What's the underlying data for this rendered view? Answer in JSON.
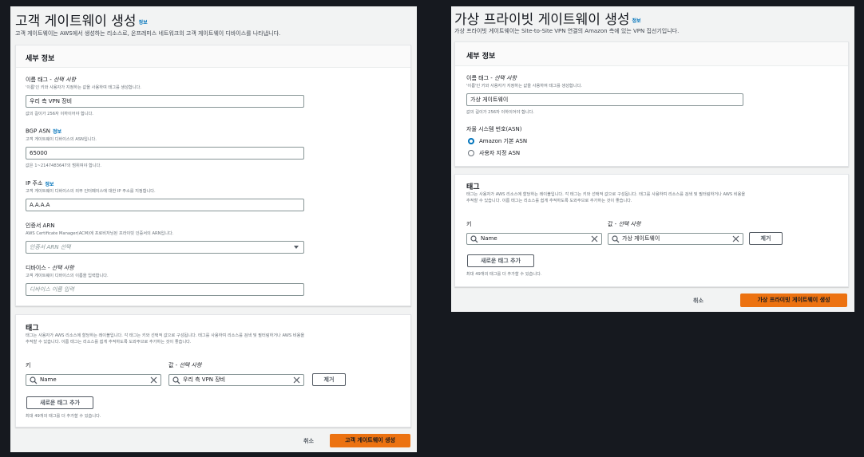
{
  "left": {
    "title": "고객 게이트웨이 생성",
    "info": "정보",
    "subtitle": "고객 게이트웨이는 AWS에서 생성하는 리소스로, 온프레미스 네트워크의 고객 게이트웨이 디바이스를 나타냅니다.",
    "details": {
      "heading": "세부 정보",
      "name_tag": {
        "label": "이름 태그",
        "optional": "선택 사항",
        "desc": "'이름'인 키와 사용자가 지정하는 값을 사용하여 태그를 생성합니다.",
        "value": "우리 측 VPN 장비",
        "hint": "값의 길이가 256자 이하이어야 합니다."
      },
      "bgp": {
        "label": "BGP ASN",
        "info": "정보",
        "desc": "고객 게이트웨이 디바이스의 ASN입니다.",
        "value": "65000",
        "hint": "값은 1~2147483647의 범위여야 합니다."
      },
      "ip": {
        "label": "IP 주소",
        "info": "정보",
        "desc": "고객 게이트웨이 디바이스의 외부 인터페이스에 대한 IP 주소를 지정합니다.",
        "value": "A.A.A.A"
      },
      "cert": {
        "label": "인증서 ARN",
        "desc": "AWS Certificate Manager(ACM)에 프로비저닝된 프라이빗 인증서의 ARN입니다.",
        "placeholder": "인증서 ARN 선택"
      },
      "device": {
        "label": "디바이스",
        "optional": "선택 사항",
        "desc": "고객 게이트웨이 디바이스의 이름을 입력합니다.",
        "placeholder": "디바이스 이름 입력"
      }
    },
    "tags": {
      "heading": "태그",
      "desc1": "태그는 사용자가 AWS 리소스에 할당하는 레이블입니다. 각 태그는 키와 선택적 값으로 구성됩니다. 태그를 사용하여 리소스를 검색 및 필터링하거나 AWS 비용을",
      "desc2": "추적할 수 있습니다. 이름 태그는 리소스를 쉽게 추적하도록 도와주므로 추가하는 것이 좋습니다.",
      "key_label": "키",
      "value_label": "값",
      "value_optional": "선택 사항",
      "key_value": "Name",
      "value_value": "우리 측 VPN 장비",
      "remove": "제거",
      "add": "새로운 태그 추가",
      "hint": "최대 49개의 태그를 더 추가할 수 있습니다."
    },
    "cancel": "취소",
    "submit": "고객 게이트웨이 생성"
  },
  "right": {
    "title": "가상 프라이빗 게이트웨이 생성",
    "info": "정보",
    "subtitle": "가상 프라이빗 게이트웨이는 Site-to-Site VPN 연결의 Amazon 측에 있는 VPN 집선기입니다.",
    "details": {
      "heading": "세부 정보",
      "name_tag": {
        "label": "이름 태그",
        "optional": "선택 사항",
        "desc": "'이름'인 키와 사용자가 지정하는 값을 사용하여 태그를 생성합니다.",
        "value": "가상 게이트웨이",
        "hint": "값의 길이가 256자 이하이어야 합니다."
      },
      "asn": {
        "label": "자율 시스템 번호(ASN)",
        "options": [
          "Amazon 기본 ASN",
          "사용자 지정 ASN"
        ],
        "selected": "Amazon 기본 ASN"
      }
    },
    "tags": {
      "heading": "태그",
      "desc1": "태그는 사용자가 AWS 리소스에 할당하는 레이블입니다. 각 태그는 키와 선택적 값으로 구성됩니다. 태그를 사용하여 리소스를 검색 및 필터링하거나 AWS 비용을",
      "desc2": "추적할 수 있습니다. 이름 태그는 리소스를 쉽게 추적하도록 도와주므로 추가하는 것이 좋습니다.",
      "key_label": "키",
      "value_label": "값",
      "value_optional": "선택 사항",
      "key_value": "Name",
      "value_value": "가상 게이트웨이",
      "remove": "제거",
      "add": "새로운 태그 추가",
      "hint": "최대 49개의 태그를 더 추가할 수 있습니다."
    },
    "cancel": "취소",
    "submit": "가상 프라이빗 게이트웨이 생성"
  },
  "colors": {
    "primary_button": "#ec7211",
    "link": "#0073bb",
    "background": "#16191f",
    "panel": "#f2f3f3"
  }
}
